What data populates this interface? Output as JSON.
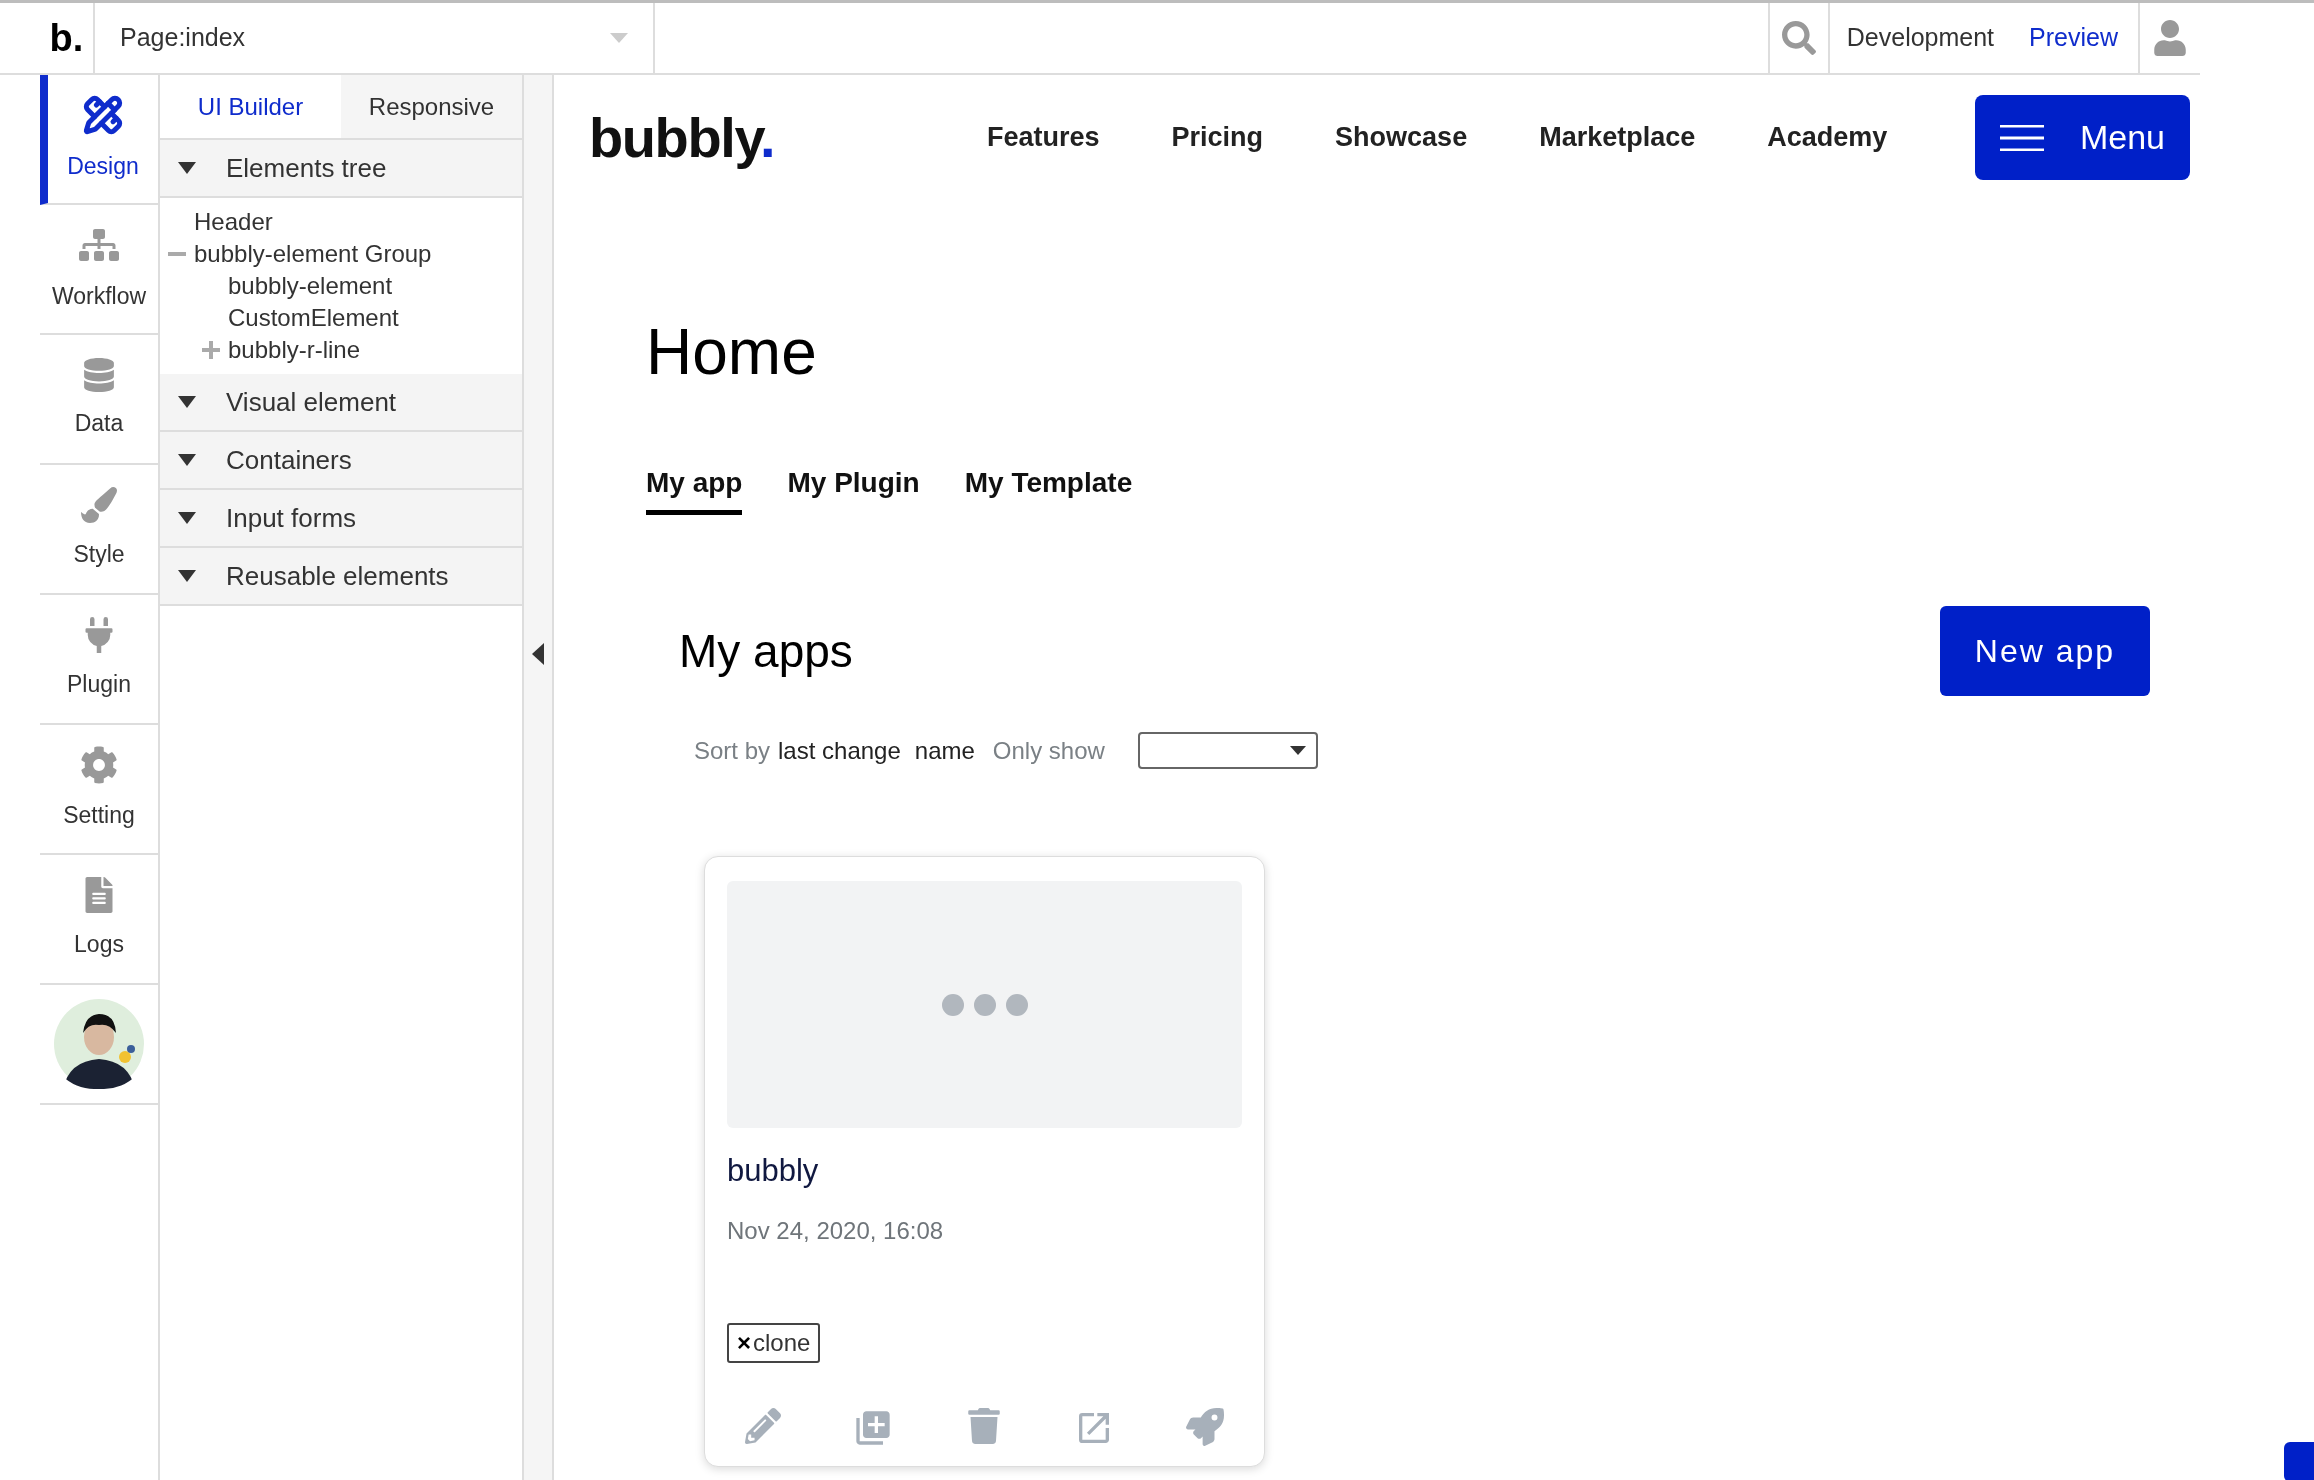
{
  "editor_bar": {
    "logo": "b.",
    "page_selector": "Page:index",
    "mode": "Development",
    "preview": "Preview"
  },
  "sidebar": {
    "items": [
      {
        "label": "Design",
        "selected": true
      },
      {
        "label": "Workflow",
        "selected": false
      },
      {
        "label": "Data",
        "selected": false
      },
      {
        "label": "Style",
        "selected": false
      },
      {
        "label": "Plugin",
        "selected": false
      },
      {
        "label": "Setting",
        "selected": false
      },
      {
        "label": "Logs",
        "selected": false
      }
    ]
  },
  "panel": {
    "tabs": [
      {
        "label": "UI Builder",
        "selected": true
      },
      {
        "label": "Responsive",
        "selected": false
      }
    ],
    "sections": [
      {
        "label": "Elements tree",
        "items": [
          {
            "label": "Header"
          },
          {
            "label": "bubbly-element Group",
            "expanded": true,
            "children": [
              {
                "label": "bubbly-element CustomElement"
              },
              {
                "label": "bubbly-r-line",
                "expanded": false
              }
            ]
          }
        ]
      },
      {
        "label": "Visual element"
      },
      {
        "label": "Containers"
      },
      {
        "label": "Input forms"
      },
      {
        "label": "Reusable elements"
      }
    ]
  },
  "site": {
    "logo": "bubbly",
    "logo_mark": ".",
    "nav": [
      "Features",
      "Pricing",
      "Showcase",
      "Marketplace",
      "Academy"
    ],
    "menu_button": "Menu"
  },
  "page_title": "Home",
  "tabs": [
    {
      "label": "My app",
      "selected": true
    },
    {
      "label": "My Plugin",
      "selected": false
    },
    {
      "label": "My Template",
      "selected": false
    }
  ],
  "section_title": "My apps",
  "new_app_button": "New app",
  "sort": {
    "label": "Sort by",
    "options": [
      "last change",
      "name"
    ],
    "filter_label": "Only show"
  },
  "apps": [
    {
      "name": "bubbly",
      "date": "Nov 24, 2020, 16:08",
      "tags": [
        {
          "remove": "×",
          "label": "clone"
        }
      ]
    }
  ]
}
